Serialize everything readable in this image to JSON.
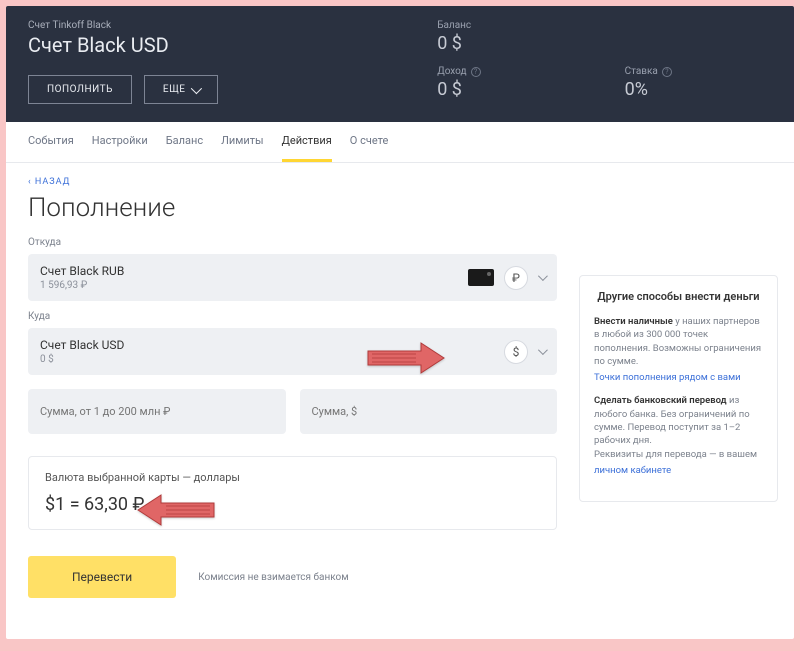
{
  "header": {
    "product": "Счет Tinkoff Black",
    "account": "Счет Black USD",
    "topup_btn": "ПОПОЛНИТЬ",
    "more_btn": "ЕЩЕ",
    "stats": {
      "balance_lbl": "Баланс",
      "balance_val": "0 $",
      "income_lbl": "Доход",
      "income_val": "0 $",
      "rate_lbl": "Ставка",
      "rate_val": "0%"
    }
  },
  "tabs": [
    "События",
    "Настройки",
    "Баланс",
    "Лимиты",
    "Действия",
    "О счете"
  ],
  "active_tab": "Действия",
  "back": "‹ НАЗАД",
  "title": "Пополнение",
  "from_lbl": "Откуда",
  "from": {
    "name": "Счет Black RUB",
    "amount": "1 596,93 ₽",
    "currency": "₽"
  },
  "to_lbl": "Куда",
  "to": {
    "name": "Счет Black USD",
    "amount": "0 $",
    "currency": "$"
  },
  "amount_rub_ph": "Сумма, от 1 до 200 млн ₽",
  "amount_usd_ph": "Сумма, $",
  "rate_box_lbl": "Валюта выбранной карты — доллары",
  "rate_box_val": "$1 = 63,30 ₽",
  "transfer_btn": "Перевести",
  "fee_note": "Комиссия не взимается банком",
  "side": {
    "title": "Другие способы внести деньги",
    "opt1_b": "Внести наличные",
    "opt1_t": " у наших партнеров в любой из 300 000 точек пополнения. Возможны ограничения по сумме.",
    "opt1_a": "Точки пополнения рядом с вами",
    "opt2_b": "Сделать банковский перевод",
    "opt2_t": " из любого банка. Без ограничений по сумме. Перевод поступит за 1–2 рабочих дня.",
    "opt2_t2": "Реквизиты для перевода — в вашем ",
    "opt2_a": "личном кабинете"
  }
}
